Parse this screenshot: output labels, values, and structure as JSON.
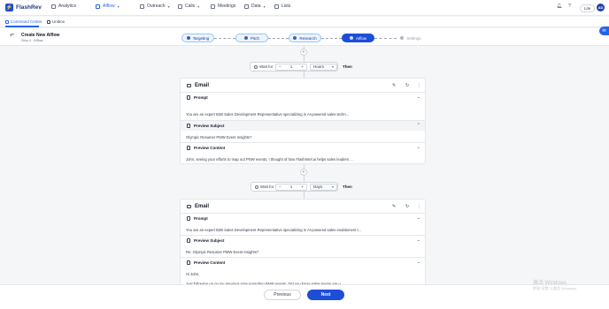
{
  "app": {
    "name": "FlashRev"
  },
  "nav": {
    "items": [
      {
        "label": "Analytics"
      },
      {
        "label": "AIflow"
      },
      {
        "label": "Outreach"
      },
      {
        "label": "Calls"
      },
      {
        "label": "Meetings"
      },
      {
        "label": "Data"
      },
      {
        "label": "Lists"
      }
    ],
    "active": "AIflow",
    "plan_badge": "Lite",
    "avatar": "AD"
  },
  "subtabs": [
    {
      "label": "Command Center"
    },
    {
      "label": "Unibox"
    }
  ],
  "page": {
    "title": "Create New AIflow",
    "step_text": "Step 4 · AIflow"
  },
  "steps": [
    {
      "label": "Targeting"
    },
    {
      "label": "Pitch"
    },
    {
      "label": "Research"
    },
    {
      "label": "AIflow"
    },
    {
      "label": "Settings"
    }
  ],
  "waits": [
    {
      "label": "Wait for",
      "value": "1",
      "unit": "Hours",
      "then": "Then"
    },
    {
      "label": "Wait for",
      "value": "1",
      "unit": "Days",
      "then": "Then"
    }
  ],
  "emails": [
    {
      "title": "Email",
      "prompt_label": "Prompt",
      "prompt_text": "You are an expert B2B Sales Development Representative specializing in AI-powered sales techn...",
      "subject_label": "Preview Subject",
      "subject_text": "Olympic Resumer PMW Event Insights?",
      "content_label": "Preview Content",
      "content_text": "John, seeing your efforts to map out PNW events, I thought of how FlashIntel.ai helps sales leaders ..."
    },
    {
      "title": "Email",
      "prompt_label": "Prompt",
      "prompt_text": "You are an expert B2B Sales Development Representative specializing in AI-powered sales enablement t...",
      "subject_label": "Preview Subject",
      "subject_text": "Re: Olympic Resumer PMW Event Insights?",
      "content_label": "Preview Content",
      "content_line1": "Hi John,",
      "content_line2": "Just following up on my previous note regarding PNW events. Did you know sales teams are u..."
    }
  ],
  "footer": {
    "previous": "Previous",
    "next": "Next"
  },
  "watermark": {
    "line1": "激活 Windows",
    "line2": "转到\"设置\"以激活 Windows。"
  },
  "colors": {
    "accent": "#1d4ed8",
    "brand": "#1e3a8a"
  }
}
